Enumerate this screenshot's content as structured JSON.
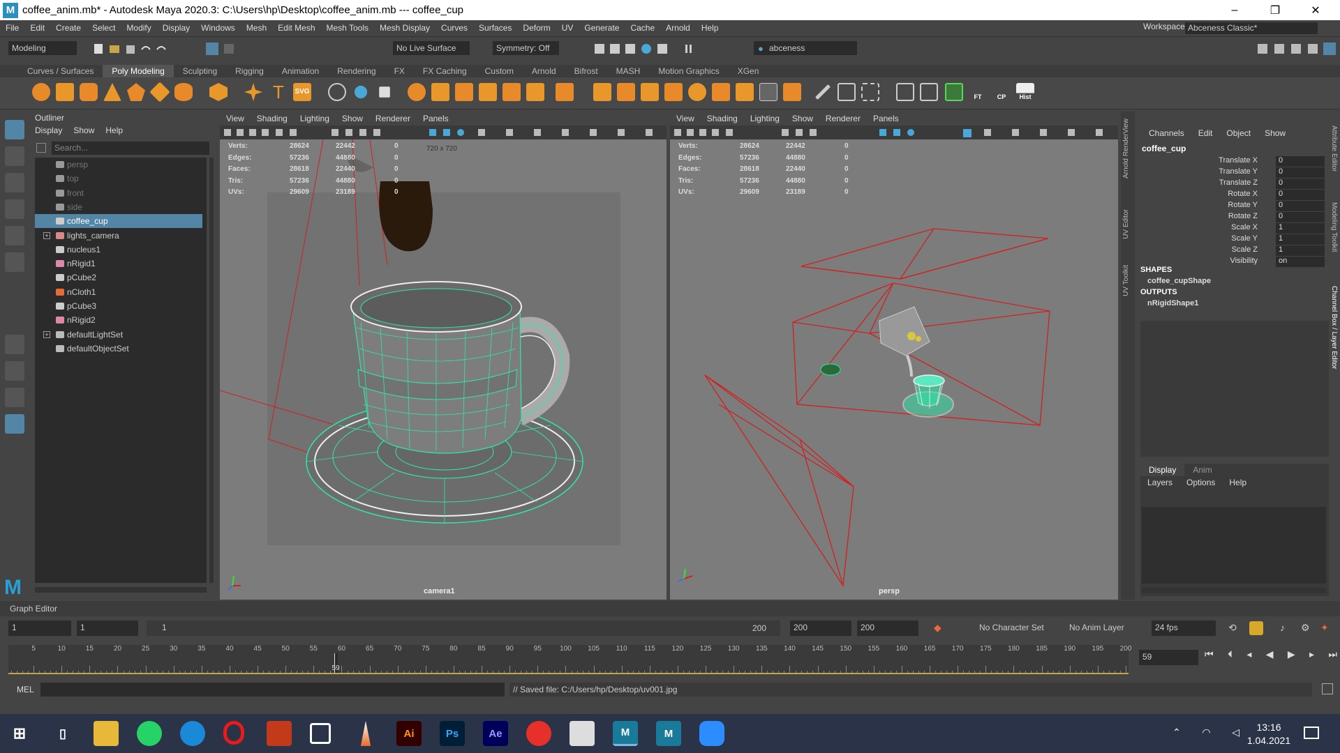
{
  "window": {
    "title": "coffee_anim.mb* - Autodesk Maya 2020.3: C:\\Users\\hp\\Desktop\\coffee_anim.mb   ---   coffee_cup",
    "controls": [
      "–",
      "❐",
      "✕"
    ]
  },
  "menus": [
    "File",
    "Edit",
    "Create",
    "Select",
    "Modify",
    "Display",
    "Windows",
    "Mesh",
    "Edit Mesh",
    "Mesh Tools",
    "Mesh Display",
    "Curves",
    "Surfaces",
    "Deform",
    "UV",
    "Generate",
    "Cache",
    "Arnold",
    "Help"
  ],
  "workspace": {
    "label": "Workspace :",
    "value": "Abceness Classic*"
  },
  "status_line": {
    "mode": "Modeling",
    "live_surface": "No Live Surface",
    "symmetry": "Symmetry: Off",
    "user": "abceness"
  },
  "shelf_tabs": [
    "Curves / Surfaces",
    "Poly Modeling",
    "Sculpting",
    "Rigging",
    "Animation",
    "Rendering",
    "FX",
    "FX Caching",
    "Custom",
    "Arnold",
    "Bifrost",
    "MASH",
    "Motion Graphics",
    "XGen"
  ],
  "shelf_active": "Poly Modeling",
  "shelf_labels": {
    "svg": "SVG",
    "ft": "FT",
    "cp": "CP",
    "hist": "Hist"
  },
  "outliner": {
    "title": "Outliner",
    "menu": [
      "Display",
      "Show",
      "Help"
    ],
    "search_placeholder": "Search...",
    "items": [
      {
        "label": "persp",
        "icon": "camera-icon",
        "dim": true
      },
      {
        "label": "top",
        "icon": "camera-icon",
        "dim": true
      },
      {
        "label": "front",
        "icon": "camera-icon",
        "dim": true
      },
      {
        "label": "side",
        "icon": "camera-icon",
        "dim": true
      },
      {
        "label": "coffee_cup",
        "icon": "mesh-icon",
        "selected": true
      },
      {
        "label": "lights_camera",
        "icon": "group-icon",
        "expandable": true
      },
      {
        "label": "nucleus1",
        "icon": "nucleus-icon"
      },
      {
        "label": "nRigid1",
        "icon": "nrigid-icon"
      },
      {
        "label": "pCube2",
        "icon": "mesh-icon"
      },
      {
        "label": "nCloth1",
        "icon": "ncloth-icon"
      },
      {
        "label": "pCube3",
        "icon": "mesh-icon"
      },
      {
        "label": "nRigid2",
        "icon": "nrigid-icon"
      },
      {
        "label": "defaultLightSet",
        "icon": "set-icon",
        "expandable": true
      },
      {
        "label": "defaultObjectSet",
        "icon": "set-icon"
      }
    ]
  },
  "viewport_menu": [
    "View",
    "Shading",
    "Lighting",
    "Show",
    "Renderer",
    "Panels"
  ],
  "hud": {
    "rows": [
      {
        "label": "Verts:",
        "a": "28624",
        "b": "22442",
        "c": "0"
      },
      {
        "label": "Edges:",
        "a": "57236",
        "b": "44880",
        "c": "0"
      },
      {
        "label": "Faces:",
        "a": "28618",
        "b": "22440",
        "c": "0"
      },
      {
        "label": "Tris:",
        "a": "57236",
        "b": "44880",
        "c": "0"
      },
      {
        "label": "UVs:",
        "a": "29609",
        "b": "23189",
        "c": "0"
      }
    ],
    "resolution": "720 x 720"
  },
  "viewports": {
    "left_camera": "camera1",
    "right_camera": "persp"
  },
  "channel_box": {
    "side_tabs": [
      "Attribute Editor",
      "Modeling Toolkit",
      "Channel Box / Layer Editor"
    ],
    "left_tabs": [
      "Arnold RenderView",
      "UV Editor",
      "UV Toolkit"
    ],
    "menu": [
      "Channels",
      "Edit",
      "Object",
      "Show"
    ],
    "object": "coffee_cup",
    "attrs": [
      {
        "name": "Translate X",
        "value": "0"
      },
      {
        "name": "Translate Y",
        "value": "0"
      },
      {
        "name": "Translate Z",
        "value": "0"
      },
      {
        "name": "Rotate X",
        "value": "0"
      },
      {
        "name": "Rotate Y",
        "value": "0"
      },
      {
        "name": "Rotate Z",
        "value": "0"
      },
      {
        "name": "Scale X",
        "value": "1"
      },
      {
        "name": "Scale Y",
        "value": "1"
      },
      {
        "name": "Scale Z",
        "value": "1"
      },
      {
        "name": "Visibility",
        "value": "on"
      }
    ],
    "shapes_header": "SHAPES",
    "shape": "coffee_cupShape",
    "outputs_header": "OUTPUTS",
    "output": "nRigidShape1"
  },
  "layer_editor": {
    "tabs": [
      "Display",
      "Anim"
    ],
    "menu": [
      "Layers",
      "Options",
      "Help"
    ]
  },
  "graph_editor_label": "Graph Editor",
  "range": {
    "start": "1",
    "inner_start": "1",
    "slider_start": "1",
    "slider_end": "200",
    "inner_end": "200",
    "end": "200",
    "character_set": "No Character Set",
    "anim_layer": "No Anim Layer",
    "fps": "24 fps"
  },
  "timeline": {
    "ticks": [
      5,
      10,
      15,
      20,
      25,
      30,
      35,
      40,
      45,
      50,
      55,
      60,
      65,
      70,
      75,
      80,
      85,
      90,
      95,
      100,
      105,
      110,
      115,
      120,
      125,
      130,
      135,
      140,
      145,
      150,
      155,
      160,
      165,
      170,
      175,
      180,
      185,
      190,
      195,
      200
    ],
    "current": "59",
    "current_field": "59"
  },
  "command": {
    "lang": "MEL",
    "result": "// Saved file: C:/Users/hp/Desktop/uv001.jpg"
  },
  "taskbar": {
    "apps": [
      "start-icon",
      "task-view-icon",
      "file-explorer-icon",
      "whatsapp-icon",
      "edge-icon",
      "opera-icon",
      "filezilla-icon",
      "app-icon",
      "pen-icon",
      "illustrator-icon",
      "photoshop-icon",
      "after-effects-icon",
      "substance-icon",
      "blender-icon",
      "maya-icon",
      "maya-icon-2",
      "zoom-icon"
    ],
    "labels": {
      "ai": "Ai",
      "ps": "Ps",
      "ae": "Ae",
      "m": "M"
    },
    "time": "13:16",
    "date": "1.04.2021"
  },
  "colors": {
    "accent": "#5285a6",
    "wire": "#2ee8a8",
    "camera": "#d12020",
    "bg": "#444444"
  }
}
